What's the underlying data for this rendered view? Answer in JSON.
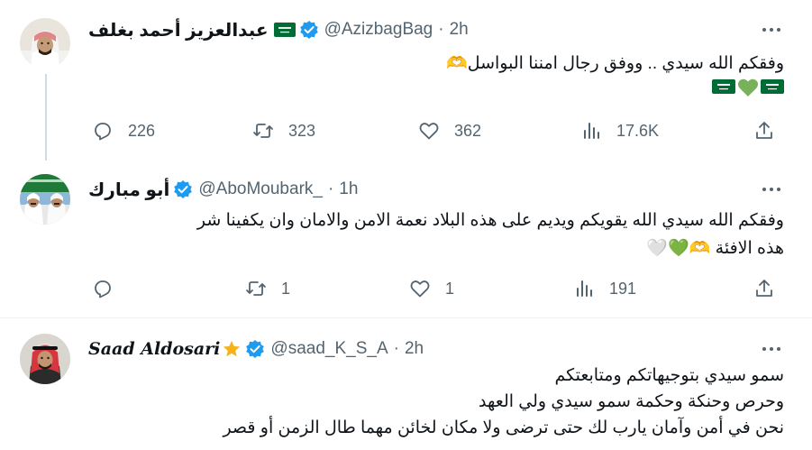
{
  "tweets": [
    {
      "name": "عبدالعزيز أحمد بغلف",
      "handle": "@AzizbagBag",
      "time": "2h",
      "lines": [
        "وفقكم الله سيدي .. ووفق رجال امننا البواسل🫶"
      ],
      "emoji_row": [
        "saudi-flag",
        "green-heart",
        "saudi-flag"
      ],
      "reply_count": "226",
      "retweet_count": "323",
      "like_count": "362",
      "view_count": "17.6K"
    },
    {
      "name": "أبو مبارك",
      "handle": "@AboMoubark_",
      "time": "1h",
      "lines": [
        "وفقكم الله سيدي الله يقويكم ويديم على هذه البلاد نعمة الامن والامان وان يكفينا شر",
        "هذه الافئة 🫶💚🤍"
      ],
      "reply_count": "",
      "retweet_count": "1",
      "like_count": "1",
      "view_count": "191"
    },
    {
      "name": "Saad Aldosari",
      "name_suffix": "⭐",
      "handle": "@saad_K_S_A",
      "time": "2h",
      "lines": [
        "سمو سيدي بتوجيهاتكم ومتابعتكم",
        "وحرص وحنكة وحكمة سمو سيدي ولي العهد",
        "نحن في أمن وآمان يارب لك حتى ترضى ولا مكان لخائن مهما طال الزمن أو قصر"
      ]
    }
  ],
  "colors": {
    "verified": "#1d9bf0",
    "secondary_text": "#536471",
    "divider": "#eff3f4"
  },
  "icons": {
    "reply": "reply-icon",
    "retweet": "retweet-icon",
    "like": "heart-icon",
    "views": "views-icon",
    "share": "share-icon",
    "more": "more-icon",
    "verified": "verified-badge-icon"
  }
}
